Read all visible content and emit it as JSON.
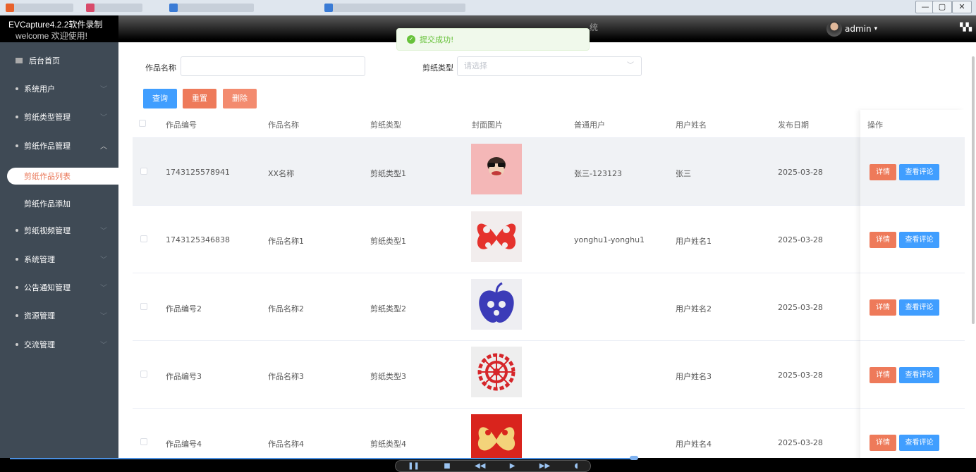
{
  "os": {
    "minimize": "—",
    "restore": "▢",
    "close": "✕"
  },
  "header": {
    "app_title": "EVCapture4.2.2软件录制",
    "welcome": "welcome 欢迎使用!",
    "system_title": "统",
    "user": "admin",
    "user_caret": "▾"
  },
  "toast": {
    "message": "提交成功!"
  },
  "sidebar": {
    "items": [
      {
        "label": "后台首页"
      },
      {
        "label": "系统用户"
      },
      {
        "label": "剪纸类型管理"
      },
      {
        "label": "剪纸作品管理"
      },
      {
        "label": "剪纸作品列表"
      },
      {
        "label": "剪纸作品添加"
      },
      {
        "label": "剪纸视频管理"
      },
      {
        "label": "系统管理"
      },
      {
        "label": "公告通知管理"
      },
      {
        "label": "资源管理"
      },
      {
        "label": "交流管理"
      }
    ]
  },
  "search": {
    "name_label": "作品名称",
    "name_value": "",
    "type_label": "剪纸类型",
    "type_placeholder": "请选择",
    "query_btn": "查询",
    "reset_btn": "重置",
    "delete_btn": "删除"
  },
  "table": {
    "columns": [
      "作品编号",
      "作品名称",
      "剪纸类型",
      "封面图片",
      "普通用户",
      "用户姓名",
      "发布日期",
      "操作"
    ],
    "rows": [
      {
        "id": "1743125578941",
        "name": "XX名称",
        "type": "剪纸类型1",
        "user": "张三-123123",
        "username": "张三",
        "date": "2025-03-28",
        "cover": "monkey"
      },
      {
        "id": "1743125346838",
        "name": "作品名称1",
        "type": "剪纸类型1",
        "user": "yonghu1-yonghu1",
        "username": "用户姓名1",
        "date": "2025-03-28",
        "cover": "red-butterfly"
      },
      {
        "id": "作品编号2",
        "name": "作品名称2",
        "type": "剪纸类型2",
        "user": "",
        "username": "用户姓名2",
        "date": "2025-03-28",
        "cover": "blue-apple"
      },
      {
        "id": "作品编号3",
        "name": "作品名称3",
        "type": "剪纸类型3",
        "user": "",
        "username": "用户姓名3",
        "date": "2025-03-28",
        "cover": "red-flower"
      },
      {
        "id": "作品编号4",
        "name": "作品名称4",
        "type": "剪纸类型4",
        "user": "",
        "username": "用户姓名4",
        "date": "2025-03-28",
        "cover": "gold-butterfly"
      }
    ],
    "detail_btn": "详情",
    "comment_btn": "查看评论"
  },
  "colors": {
    "primary": "#409eff",
    "accent": "#ee7a5a",
    "danger_light": "#f38b6f",
    "sidebar_bg": "#3f4a55",
    "success": "#67c23a"
  }
}
